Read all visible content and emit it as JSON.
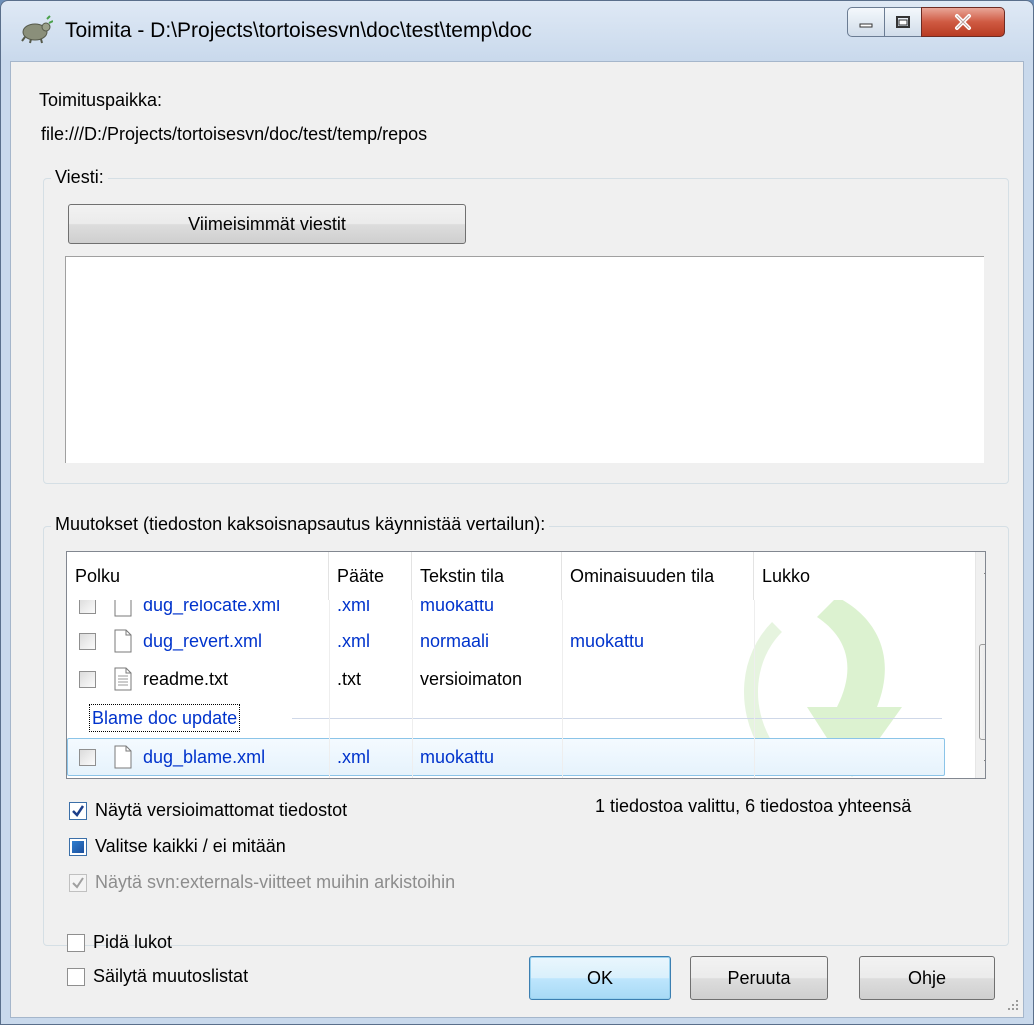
{
  "window": {
    "title": "Toimita - D:\\Projects\\tortoisesvn\\doc\\test\\temp\\doc"
  },
  "commit_location": {
    "label": "Toimituspaikka:",
    "url": "file:///D:/Projects/tortoisesvn/doc/test/temp/repos"
  },
  "message_group": {
    "title": "Viesti:",
    "recent_button": "Viimeisimmät viestit",
    "text": ""
  },
  "changes_group": {
    "title": "Muutokset (tiedoston kaksoisnapsautus käynnistää vertailun):",
    "columns": [
      "Polku",
      "Pääte",
      "Tekstin tila",
      "Ominaisuuden tila",
      "Lukko"
    ],
    "rows": [
      {
        "path": "dug_relocate.xml",
        "ext": ".xml",
        "text_status": "muokattu",
        "prop_status": "",
        "lock": ""
      },
      {
        "path": "dug_revert.xml",
        "ext": ".xml",
        "text_status": "normaali",
        "prop_status": "muokattu",
        "lock": ""
      },
      {
        "path": "readme.txt",
        "ext": ".txt",
        "text_status": "versioimaton",
        "prop_status": "",
        "lock": ""
      }
    ],
    "changelist_header": "Blame doc update",
    "changelist_rows": [
      {
        "path": "dug_blame.xml",
        "ext": ".xml",
        "text_status": "muokattu",
        "prop_status": "",
        "lock": ""
      }
    ],
    "summary": "1 tiedostoa valittu, 6 tiedostoa yhteensä",
    "show_unversioned": "Näytä versioimattomat tiedostot",
    "select_all": "Valitse kaikki / ei mitään",
    "show_externals": "Näytä svn:externals-viitteet muihin arkistoihin"
  },
  "footer": {
    "keep_locks": "Pidä lukot",
    "keep_changelists": "Säilytä muutoslistat",
    "ok": "OK",
    "cancel": "Peruuta",
    "help": "Ohje"
  }
}
